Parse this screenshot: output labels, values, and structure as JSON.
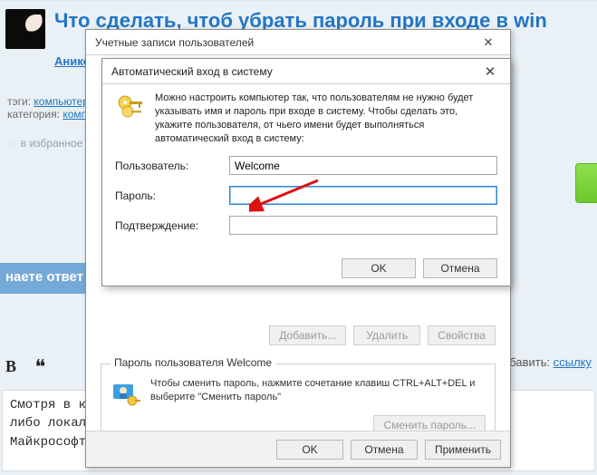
{
  "forum": {
    "title": "Что сделать, чтоб убрать пароль при входе в win",
    "author": "Аникс I",
    "tags_label": "тэги:",
    "tag1": "компьютер",
    "cat_label": "категория:",
    "cat1": "компь",
    "favorite": "в избранное",
    "answers_bar": "наете ответ",
    "add_label": "добавить:",
    "add_link": "ссылку",
    "answer_text": "Смотря в ка                                        ановке? Учетна\nлибо локальн\nМайкрософт"
  },
  "parent_dialog": {
    "title": "Учетные записи пользователей",
    "btn_add": "Добавить...",
    "btn_del": "Удалить",
    "btn_props": "Свойства",
    "pwd_group_legend": "Пароль пользователя Welcome",
    "pwd_hint": "Чтобы сменить пароль, нажмите сочетание клавиш CTRL+ALT+DEL и выберите \"Сменить пароль\"",
    "btn_change_pwd": "Сменить пароль...",
    "ok": "OK",
    "cancel": "Отмена",
    "apply": "Применить"
  },
  "child_dialog": {
    "title": "Автоматический вход в систему",
    "desc": "Можно настроить компьютер так, что пользователям не нужно будет указывать имя и пароль при входе в систему. Чтобы сделать это, укажите пользователя, от чьего имени будет выполняться автоматический вход в систему:",
    "user_label": "Пользователь:",
    "user_value": "Welcome",
    "pwd_label": "Пароль:",
    "pwd_value": "",
    "confirm_label": "Подтверждение:",
    "confirm_value": "",
    "ok": "OK",
    "cancel": "Отмена"
  }
}
